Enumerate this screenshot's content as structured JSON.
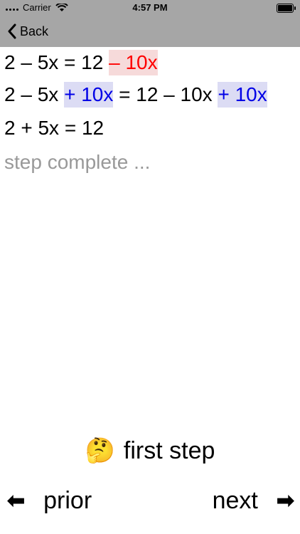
{
  "status_bar": {
    "carrier": "Carrier",
    "time": "4:57 PM"
  },
  "nav": {
    "back_label": "Back"
  },
  "steps": [
    {
      "parts": [
        {
          "text": "2 – 5x = 12 ",
          "style": "plain"
        },
        {
          "text": "– 10x",
          "style": "red"
        }
      ]
    },
    {
      "parts": [
        {
          "text": "2 – 5x ",
          "style": "plain"
        },
        {
          "text": "+ 10x",
          "style": "blue"
        },
        {
          "text": " = 12 – 10x ",
          "style": "plain"
        },
        {
          "text": "+ 10x",
          "style": "blue"
        }
      ]
    },
    {
      "parts": [
        {
          "text": "2 + 5x = 12",
          "style": "plain"
        }
      ]
    }
  ],
  "status_text": "step complete ...",
  "hint": {
    "emoji": "🤔",
    "label": "first step"
  },
  "controls": {
    "prior_arrow": "⬅",
    "prior_label": "prior",
    "next_label": "next",
    "next_arrow": "➡"
  },
  "colors": {
    "bar": "#a6a6a6",
    "red_highlight": "#f6dada",
    "blue_highlight": "#dcdcf4"
  }
}
